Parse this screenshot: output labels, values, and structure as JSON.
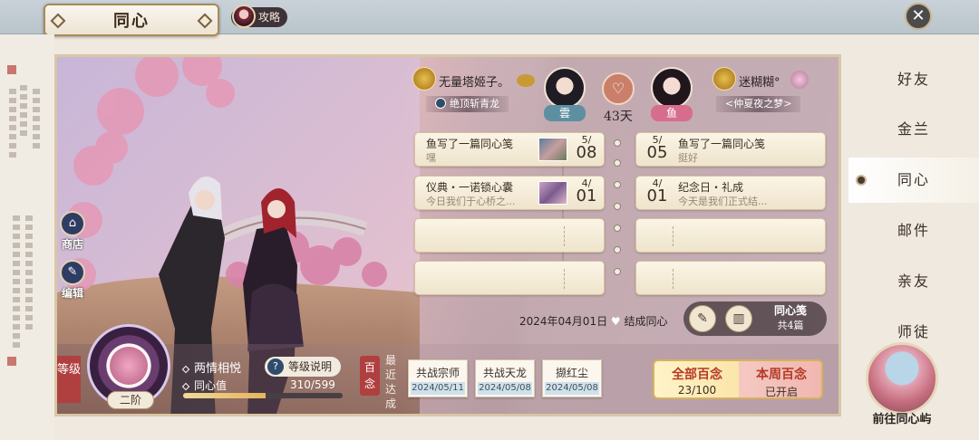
{
  "header": {
    "title": "同心",
    "guide_label": "攻略",
    "close_symbol": "✕"
  },
  "sidebar": {
    "items": [
      {
        "label": "好友",
        "active": false
      },
      {
        "label": "金兰",
        "active": false
      },
      {
        "label": "同心",
        "active": true
      },
      {
        "label": "邮件",
        "active": false
      },
      {
        "label": "亲友",
        "active": false
      },
      {
        "label": "师徒",
        "active": false
      }
    ],
    "island_label": "前往同心屿"
  },
  "scene_buttons": {
    "shop_label": "商店",
    "edit_label": "编辑"
  },
  "couple": {
    "left": {
      "name": "无量塔姬子。",
      "title": "绝顶斩青龙",
      "tag": "雲"
    },
    "right": {
      "name": "迷糊糊°",
      "title": "<仲夏夜之梦>",
      "tag": "鱼"
    },
    "days": "43天"
  },
  "letters": {
    "left": [
      {
        "title": "鱼写了一篇同心笺",
        "sub": "嘿",
        "month": "5/",
        "day": "08",
        "photo": true
      },
      {
        "title": "仪典・一诺锁心囊",
        "sub": "今日我们于心桥之...",
        "month": "4/",
        "day": "01",
        "photo": true
      },
      {
        "title": "",
        "sub": "",
        "month": "",
        "day": "",
        "photo": false
      },
      {
        "title": "",
        "sub": "",
        "month": "",
        "day": "",
        "photo": false
      }
    ],
    "right": [
      {
        "title": "鱼写了一篇同心笺",
        "sub": "挺好",
        "month": "5/",
        "day": "05"
      },
      {
        "title": "纪念日・礼成",
        "sub": "今天是我们正式结...",
        "month": "4/",
        "day": "01"
      },
      {
        "title": "",
        "sub": "",
        "month": "",
        "day": ""
      },
      {
        "title": "",
        "sub": "",
        "month": "",
        "day": ""
      }
    ]
  },
  "bond": {
    "date_text": "2024年04月01日",
    "suffix": "结成同心"
  },
  "letter_box": {
    "title": "同心笺",
    "count": "共4篇"
  },
  "level": {
    "label": "等级",
    "stage": "二阶",
    "name": "两情相悦",
    "value_label": "同心值",
    "value_text": "310/599",
    "progress": 0.518,
    "help_label": "等级说明"
  },
  "bainian": {
    "label": "百念",
    "recent_label": "最近达成",
    "achievements": [
      {
        "name": "共战宗师",
        "date": "2024/05/11"
      },
      {
        "name": "共战天龙",
        "date": "2024/05/08"
      },
      {
        "name": "撷红尘",
        "date": "2024/05/08"
      }
    ],
    "all_title": "全部百念",
    "all_value": "23/100",
    "week_title": "本周百念",
    "week_status": "已开启"
  },
  "colors": {
    "accent_red": "#b03f3f",
    "gold": "#d7b25e",
    "active_tab": "#ffffff"
  }
}
